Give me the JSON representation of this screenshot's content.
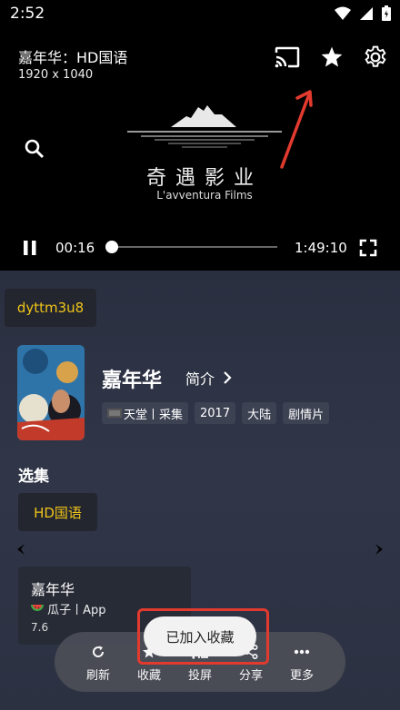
{
  "status_bar": {
    "time": "2:52"
  },
  "player": {
    "title": "嘉年华：HD国语",
    "resolution": "1920 x 1040",
    "logo_cn": "奇遇影业",
    "logo_en": "L'avventura Films",
    "current_time": "00:16",
    "total_time": "1:49:10",
    "progress": 0.0024
  },
  "source": {
    "name": "dyttm3u8"
  },
  "movie": {
    "title": "嘉年华",
    "intro_label": "简介",
    "tags": [
      "天堂丨采集",
      "2017",
      "大陆",
      "剧情片"
    ]
  },
  "episodes": {
    "section_title": "选集",
    "items": [
      "HD国语"
    ]
  },
  "related_card": {
    "title": "嘉年华",
    "source": "瓜子丨App",
    "rating": "7.6"
  },
  "toolbar": {
    "items": [
      {
        "label": "刷新",
        "icon": "refresh-icon"
      },
      {
        "label": "收藏",
        "icon": "star-icon"
      },
      {
        "label": "投屏",
        "icon": "cast-icon"
      },
      {
        "label": "分享",
        "icon": "share-icon"
      },
      {
        "label": "更多",
        "icon": "more-icon"
      }
    ]
  },
  "toast": {
    "message": "已加入收藏"
  },
  "colors": {
    "accent": "#f0c419",
    "annotation": "#e23a2e",
    "background": "#2c3142"
  }
}
